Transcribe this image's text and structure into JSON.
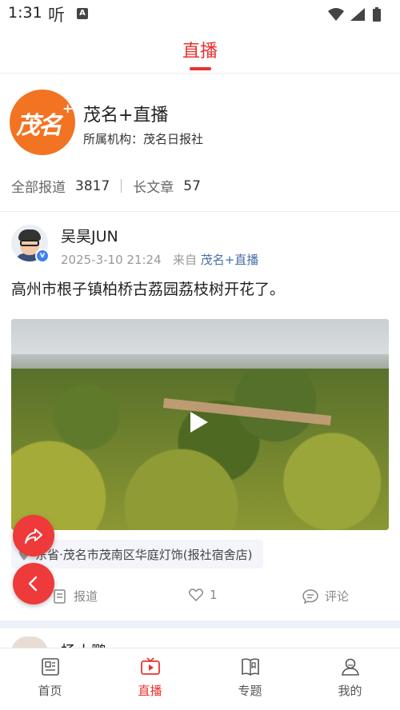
{
  "status_bar": {
    "time": "1:31",
    "listen_glyph": "听",
    "a_glyph": "A",
    "icons": [
      "wifi-icon",
      "signal-icon",
      "battery-icon"
    ]
  },
  "header": {
    "title": "直播"
  },
  "profile": {
    "logo_text": "茂名",
    "logo_plus": "+",
    "name": "茂名+直播",
    "org_label": "所属机构：",
    "org_value": "茂名日报社",
    "stats": [
      {
        "label": "全部报道",
        "value": "3817"
      },
      {
        "label": "长文章",
        "value": "57"
      }
    ]
  },
  "post": {
    "author": "吴昊JUN",
    "timestamp": "2025-3-10 21:24",
    "source_prefix": "来自",
    "source_name": "茂名+直播",
    "title": "高州市根子镇柏桥古荔园荔枝树开花了。",
    "location": "东省·茂名市茂南区华庭灯饰(报社宿舍店)",
    "actions": {
      "report": "报道",
      "likes": "1",
      "comment": "评论"
    }
  },
  "next_post": {
    "author_partial": "杨小鹏"
  },
  "tabbar": {
    "items": [
      {
        "label": "首页",
        "icon": "news-icon"
      },
      {
        "label": "直播",
        "icon": "tv-icon"
      },
      {
        "label": "专题",
        "icon": "book-icon"
      },
      {
        "label": "我的",
        "icon": "user-icon"
      }
    ],
    "active": "直播"
  },
  "colors": {
    "accent": "#e8322e",
    "logo_bg": "#f27322",
    "link": "#4a6fa5"
  }
}
